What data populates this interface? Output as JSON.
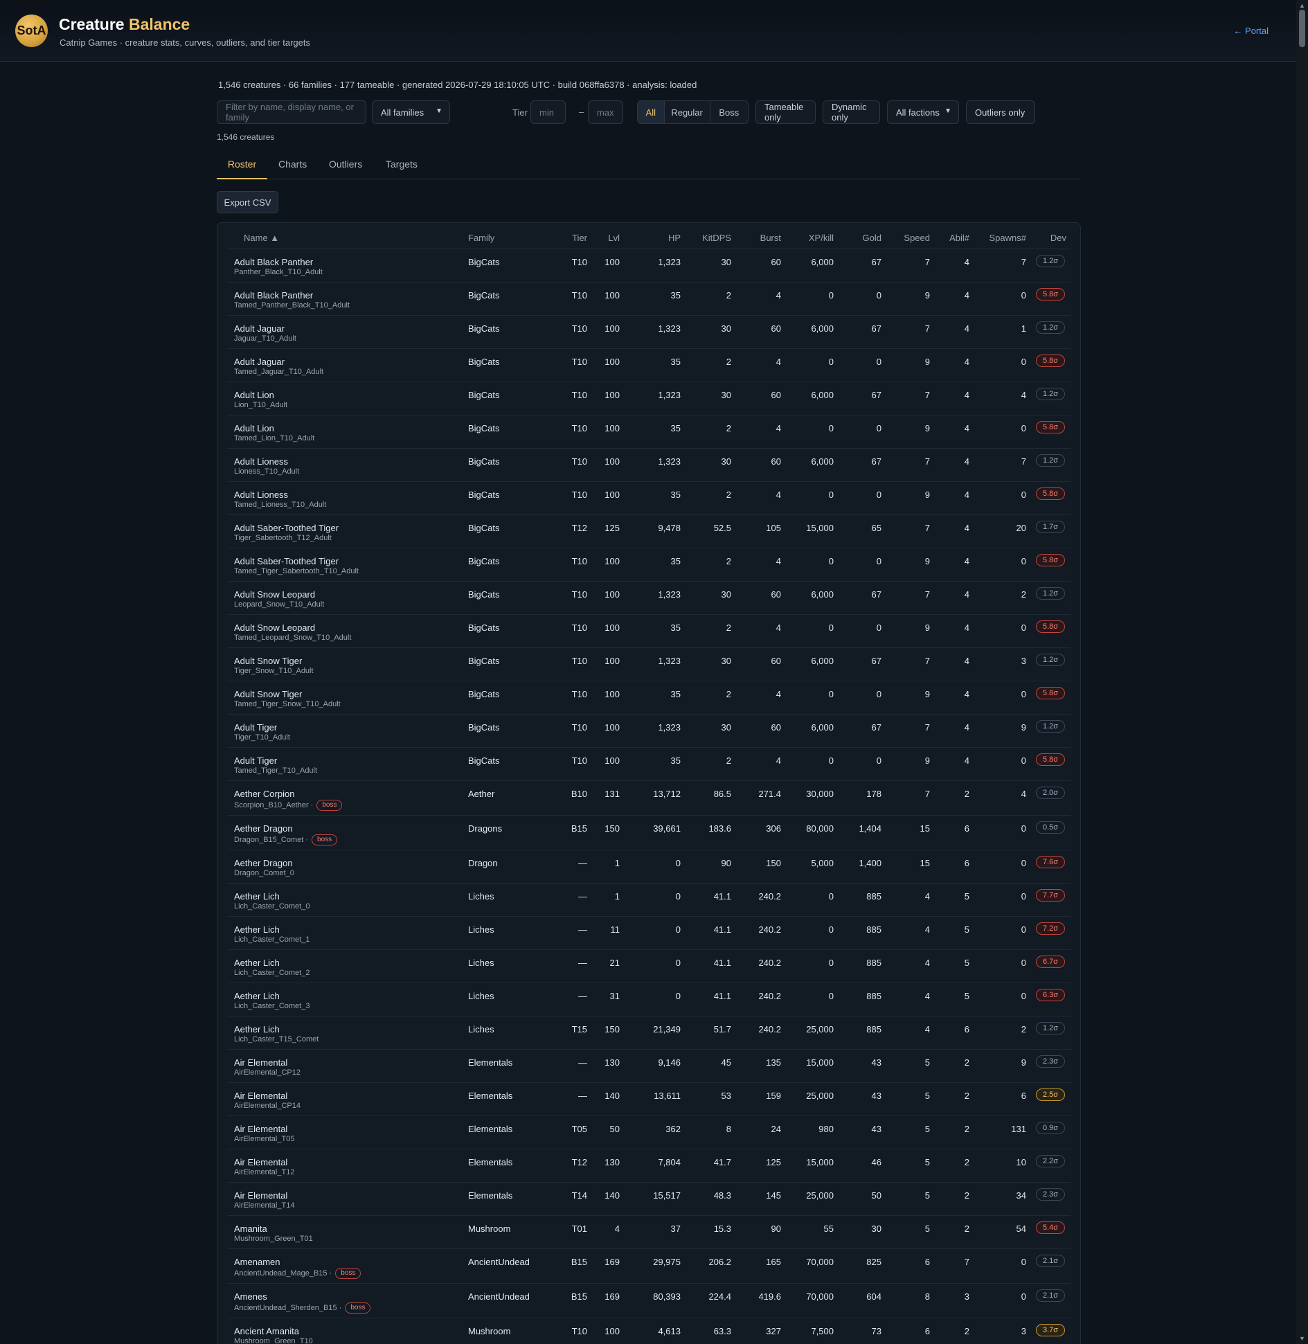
{
  "header": {
    "logo_text": "SotA",
    "title_main": "Creature",
    "title_accent": "Balance",
    "subtitle": "Catnip Games · creature stats, curves, outliers, and tier targets",
    "portal_link": "← Portal"
  },
  "meta": "1,546 creatures · 66 families · 177 tameable · generated 2026-07-29 18:10:05 UTC · build 068ffa6378 · analysis: loaded",
  "controls": {
    "search_placeholder": "Filter by name, display name, or family",
    "family_select": "All families",
    "tier_label": "Tier",
    "tier_min_placeholder": "min",
    "tier_max_placeholder": "max",
    "tier_dash": "–",
    "seg_all": "All",
    "seg_regular": "Regular",
    "seg_boss": "Boss",
    "tameable_only": "Tameable only",
    "dynamic_only": "Dynamic only",
    "faction_select": "All factions",
    "outliers_only": "Outliers only"
  },
  "count": "1,546 creatures",
  "tabs": [
    "Roster",
    "Charts",
    "Outliers",
    "Targets"
  ],
  "export_label": "Export CSV",
  "columns": {
    "name": "Name ▲",
    "family": "Family",
    "tier": "Tier",
    "lvl": "Lvl",
    "hp": "HP",
    "kitdps": "KitDPS",
    "burst": "Burst",
    "xp": "XP/kill",
    "gold": "Gold",
    "speed": "Speed",
    "abil": "Abil#",
    "spawns": "Spawns#",
    "dev": "Dev"
  },
  "colors": {
    "accent": "#f0c26a",
    "link": "#58a6ff",
    "bad": "#ff7a72",
    "warn": "#f0c26a"
  },
  "rows": [
    {
      "name": "Adult Black Panther",
      "sub": "Panther_Black_T10_Adult",
      "boss": false,
      "family": "BigCats",
      "tier": "T10",
      "lvl": "100",
      "hp": "1,323",
      "kitdps": "30",
      "burst": "60",
      "xp": "6,000",
      "gold": "67",
      "speed": "7",
      "abil": "4",
      "spawns": "7",
      "dev": "1.2σ",
      "sev": "ok"
    },
    {
      "name": "Adult Black Panther",
      "sub": "Tamed_Panther_Black_T10_Adult",
      "boss": false,
      "family": "BigCats",
      "tier": "T10",
      "lvl": "100",
      "hp": "35",
      "kitdps": "2",
      "burst": "4",
      "xp": "0",
      "gold": "0",
      "speed": "9",
      "abil": "4",
      "spawns": "0",
      "dev": "5.8σ",
      "sev": "bad"
    },
    {
      "name": "Adult Jaguar",
      "sub": "Jaguar_T10_Adult",
      "boss": false,
      "family": "BigCats",
      "tier": "T10",
      "lvl": "100",
      "hp": "1,323",
      "kitdps": "30",
      "burst": "60",
      "xp": "6,000",
      "gold": "67",
      "speed": "7",
      "abil": "4",
      "spawns": "1",
      "dev": "1.2σ",
      "sev": "ok"
    },
    {
      "name": "Adult Jaguar",
      "sub": "Tamed_Jaguar_T10_Adult",
      "boss": false,
      "family": "BigCats",
      "tier": "T10",
      "lvl": "100",
      "hp": "35",
      "kitdps": "2",
      "burst": "4",
      "xp": "0",
      "gold": "0",
      "speed": "9",
      "abil": "4",
      "spawns": "0",
      "dev": "5.8σ",
      "sev": "bad"
    },
    {
      "name": "Adult Lion",
      "sub": "Lion_T10_Adult",
      "boss": false,
      "family": "BigCats",
      "tier": "T10",
      "lvl": "100",
      "hp": "1,323",
      "kitdps": "30",
      "burst": "60",
      "xp": "6,000",
      "gold": "67",
      "speed": "7",
      "abil": "4",
      "spawns": "4",
      "dev": "1.2σ",
      "sev": "ok"
    },
    {
      "name": "Adult Lion",
      "sub": "Tamed_Lion_T10_Adult",
      "boss": false,
      "family": "BigCats",
      "tier": "T10",
      "lvl": "100",
      "hp": "35",
      "kitdps": "2",
      "burst": "4",
      "xp": "0",
      "gold": "0",
      "speed": "9",
      "abil": "4",
      "spawns": "0",
      "dev": "5.8σ",
      "sev": "bad"
    },
    {
      "name": "Adult Lioness",
      "sub": "Lioness_T10_Adult",
      "boss": false,
      "family": "BigCats",
      "tier": "T10",
      "lvl": "100",
      "hp": "1,323",
      "kitdps": "30",
      "burst": "60",
      "xp": "6,000",
      "gold": "67",
      "speed": "7",
      "abil": "4",
      "spawns": "7",
      "dev": "1.2σ",
      "sev": "ok"
    },
    {
      "name": "Adult Lioness",
      "sub": "Tamed_Lioness_T10_Adult",
      "boss": false,
      "family": "BigCats",
      "tier": "T10",
      "lvl": "100",
      "hp": "35",
      "kitdps": "2",
      "burst": "4",
      "xp": "0",
      "gold": "0",
      "speed": "9",
      "abil": "4",
      "spawns": "0",
      "dev": "5.8σ",
      "sev": "bad"
    },
    {
      "name": "Adult Saber-Toothed Tiger",
      "sub": "Tiger_Sabertooth_T12_Adult",
      "boss": false,
      "family": "BigCats",
      "tier": "T12",
      "lvl": "125",
      "hp": "9,478",
      "kitdps": "52.5",
      "burst": "105",
      "xp": "15,000",
      "gold": "65",
      "speed": "7",
      "abil": "4",
      "spawns": "20",
      "dev": "1.7σ",
      "sev": "ok"
    },
    {
      "name": "Adult Saber-Toothed Tiger",
      "sub": "Tamed_Tiger_Sabertooth_T10_Adult",
      "boss": false,
      "family": "BigCats",
      "tier": "T10",
      "lvl": "100",
      "hp": "35",
      "kitdps": "2",
      "burst": "4",
      "xp": "0",
      "gold": "0",
      "speed": "9",
      "abil": "4",
      "spawns": "0",
      "dev": "5.8σ",
      "sev": "bad"
    },
    {
      "name": "Adult Snow Leopard",
      "sub": "Leopard_Snow_T10_Adult",
      "boss": false,
      "family": "BigCats",
      "tier": "T10",
      "lvl": "100",
      "hp": "1,323",
      "kitdps": "30",
      "burst": "60",
      "xp": "6,000",
      "gold": "67",
      "speed": "7",
      "abil": "4",
      "spawns": "2",
      "dev": "1.2σ",
      "sev": "ok"
    },
    {
      "name": "Adult Snow Leopard",
      "sub": "Tamed_Leopard_Snow_T10_Adult",
      "boss": false,
      "family": "BigCats",
      "tier": "T10",
      "lvl": "100",
      "hp": "35",
      "kitdps": "2",
      "burst": "4",
      "xp": "0",
      "gold": "0",
      "speed": "9",
      "abil": "4",
      "spawns": "0",
      "dev": "5.8σ",
      "sev": "bad"
    },
    {
      "name": "Adult Snow Tiger",
      "sub": "Tiger_Snow_T10_Adult",
      "boss": false,
      "family": "BigCats",
      "tier": "T10",
      "lvl": "100",
      "hp": "1,323",
      "kitdps": "30",
      "burst": "60",
      "xp": "6,000",
      "gold": "67",
      "speed": "7",
      "abil": "4",
      "spawns": "3",
      "dev": "1.2σ",
      "sev": "ok"
    },
    {
      "name": "Adult Snow Tiger",
      "sub": "Tamed_Tiger_Snow_T10_Adult",
      "boss": false,
      "family": "BigCats",
      "tier": "T10",
      "lvl": "100",
      "hp": "35",
      "kitdps": "2",
      "burst": "4",
      "xp": "0",
      "gold": "0",
      "speed": "9",
      "abil": "4",
      "spawns": "0",
      "dev": "5.8σ",
      "sev": "bad"
    },
    {
      "name": "Adult Tiger",
      "sub": "Tiger_T10_Adult",
      "boss": false,
      "family": "BigCats",
      "tier": "T10",
      "lvl": "100",
      "hp": "1,323",
      "kitdps": "30",
      "burst": "60",
      "xp": "6,000",
      "gold": "67",
      "speed": "7",
      "abil": "4",
      "spawns": "9",
      "dev": "1.2σ",
      "sev": "ok"
    },
    {
      "name": "Adult Tiger",
      "sub": "Tamed_Tiger_T10_Adult",
      "boss": false,
      "family": "BigCats",
      "tier": "T10",
      "lvl": "100",
      "hp": "35",
      "kitdps": "2",
      "burst": "4",
      "xp": "0",
      "gold": "0",
      "speed": "9",
      "abil": "4",
      "spawns": "0",
      "dev": "5.8σ",
      "sev": "bad"
    },
    {
      "name": "Aether Corpion",
      "sub": "Scorpion_B10_Aether ·",
      "boss": true,
      "family": "Aether",
      "tier": "B10",
      "lvl": "131",
      "hp": "13,712",
      "kitdps": "86.5",
      "burst": "271.4",
      "xp": "30,000",
      "gold": "178",
      "speed": "7",
      "abil": "2",
      "spawns": "4",
      "dev": "2.0σ",
      "sev": "ok"
    },
    {
      "name": "Aether Dragon",
      "sub": "Dragon_B15_Comet ·",
      "boss": true,
      "family": "Dragons",
      "tier": "B15",
      "lvl": "150",
      "hp": "39,661",
      "kitdps": "183.6",
      "burst": "306",
      "xp": "80,000",
      "gold": "1,404",
      "speed": "15",
      "abil": "6",
      "spawns": "0",
      "dev": "0.5σ",
      "sev": "ok"
    },
    {
      "name": "Aether Dragon",
      "sub": "Dragon_Comet_0",
      "boss": false,
      "family": "Dragon",
      "tier": "—",
      "lvl": "1",
      "hp": "0",
      "kitdps": "90",
      "burst": "150",
      "xp": "5,000",
      "gold": "1,400",
      "speed": "15",
      "abil": "6",
      "spawns": "0",
      "dev": "7.6σ",
      "sev": "bad"
    },
    {
      "name": "Aether Lich",
      "sub": "Lich_Caster_Comet_0",
      "boss": false,
      "family": "Liches",
      "tier": "—",
      "lvl": "1",
      "hp": "0",
      "kitdps": "41.1",
      "burst": "240.2",
      "xp": "0",
      "gold": "885",
      "speed": "4",
      "abil": "5",
      "spawns": "0",
      "dev": "7.7σ",
      "sev": "bad"
    },
    {
      "name": "Aether Lich",
      "sub": "Lich_Caster_Comet_1",
      "boss": false,
      "family": "Liches",
      "tier": "—",
      "lvl": "11",
      "hp": "0",
      "kitdps": "41.1",
      "burst": "240.2",
      "xp": "0",
      "gold": "885",
      "speed": "4",
      "abil": "5",
      "spawns": "0",
      "dev": "7.2σ",
      "sev": "bad"
    },
    {
      "name": "Aether Lich",
      "sub": "Lich_Caster_Comet_2",
      "boss": false,
      "family": "Liches",
      "tier": "—",
      "lvl": "21",
      "hp": "0",
      "kitdps": "41.1",
      "burst": "240.2",
      "xp": "0",
      "gold": "885",
      "speed": "4",
      "abil": "5",
      "spawns": "0",
      "dev": "6.7σ",
      "sev": "bad"
    },
    {
      "name": "Aether Lich",
      "sub": "Lich_Caster_Comet_3",
      "boss": false,
      "family": "Liches",
      "tier": "—",
      "lvl": "31",
      "hp": "0",
      "kitdps": "41.1",
      "burst": "240.2",
      "xp": "0",
      "gold": "885",
      "speed": "4",
      "abil": "5",
      "spawns": "0",
      "dev": "6.3σ",
      "sev": "bad"
    },
    {
      "name": "Aether Lich",
      "sub": "Lich_Caster_T15_Comet",
      "boss": false,
      "family": "Liches",
      "tier": "T15",
      "lvl": "150",
      "hp": "21,349",
      "kitdps": "51.7",
      "burst": "240.2",
      "xp": "25,000",
      "gold": "885",
      "speed": "4",
      "abil": "6",
      "spawns": "2",
      "dev": "1.2σ",
      "sev": "ok"
    },
    {
      "name": "Air Elemental",
      "sub": "AirElemental_CP12",
      "boss": false,
      "family": "Elementals",
      "tier": "—",
      "lvl": "130",
      "hp": "9,146",
      "kitdps": "45",
      "burst": "135",
      "xp": "15,000",
      "gold": "43",
      "speed": "5",
      "abil": "2",
      "spawns": "9",
      "dev": "2.3σ",
      "sev": "ok"
    },
    {
      "name": "Air Elemental",
      "sub": "AirElemental_CP14",
      "boss": false,
      "family": "Elementals",
      "tier": "—",
      "lvl": "140",
      "hp": "13,611",
      "kitdps": "53",
      "burst": "159",
      "xp": "25,000",
      "gold": "43",
      "speed": "5",
      "abil": "2",
      "spawns": "6",
      "dev": "2.5σ",
      "sev": "warn"
    },
    {
      "name": "Air Elemental",
      "sub": "AirElemental_T05",
      "boss": false,
      "family": "Elementals",
      "tier": "T05",
      "lvl": "50",
      "hp": "362",
      "kitdps": "8",
      "burst": "24",
      "xp": "980",
      "gold": "43",
      "speed": "5",
      "abil": "2",
      "spawns": "131",
      "dev": "0.9σ",
      "sev": "ok"
    },
    {
      "name": "Air Elemental",
      "sub": "AirElemental_T12",
      "boss": false,
      "family": "Elementals",
      "tier": "T12",
      "lvl": "130",
      "hp": "7,804",
      "kitdps": "41.7",
      "burst": "125",
      "xp": "15,000",
      "gold": "46",
      "speed": "5",
      "abil": "2",
      "spawns": "10",
      "dev": "2.2σ",
      "sev": "ok"
    },
    {
      "name": "Air Elemental",
      "sub": "AirElemental_T14",
      "boss": false,
      "family": "Elementals",
      "tier": "T14",
      "lvl": "140",
      "hp": "15,517",
      "kitdps": "48.3",
      "burst": "145",
      "xp": "25,000",
      "gold": "50",
      "speed": "5",
      "abil": "2",
      "spawns": "34",
      "dev": "2.3σ",
      "sev": "ok"
    },
    {
      "name": "Amanita",
      "sub": "Mushroom_Green_T01",
      "boss": false,
      "family": "Mushroom",
      "tier": "T01",
      "lvl": "4",
      "hp": "37",
      "kitdps": "15.3",
      "burst": "90",
      "xp": "55",
      "gold": "30",
      "speed": "5",
      "abil": "2",
      "spawns": "54",
      "dev": "5.4σ",
      "sev": "bad"
    },
    {
      "name": "Amenamen",
      "sub": "AncientUndead_Mage_B15 ·",
      "boss": true,
      "family": "AncientUndead",
      "tier": "B15",
      "lvl": "169",
      "hp": "29,975",
      "kitdps": "206.2",
      "burst": "165",
      "xp": "70,000",
      "gold": "825",
      "speed": "6",
      "abil": "7",
      "spawns": "0",
      "dev": "2.1σ",
      "sev": "ok"
    },
    {
      "name": "Amenes",
      "sub": "AncientUndead_Sherden_B15 ·",
      "boss": true,
      "family": "AncientUndead",
      "tier": "B15",
      "lvl": "169",
      "hp": "80,393",
      "kitdps": "224.4",
      "burst": "419.6",
      "xp": "70,000",
      "gold": "604",
      "speed": "8",
      "abil": "3",
      "spawns": "0",
      "dev": "2.1σ",
      "sev": "ok"
    },
    {
      "name": "Ancient Amanita",
      "sub": "Mushroom_Green_T10",
      "boss": false,
      "family": "Mushroom",
      "tier": "T10",
      "lvl": "100",
      "hp": "4,613",
      "kitdps": "63.3",
      "burst": "327",
      "xp": "7,500",
      "gold": "73",
      "speed": "6",
      "abil": "2",
      "spawns": "3",
      "dev": "3.7σ",
      "sev": "warn"
    }
  ]
}
